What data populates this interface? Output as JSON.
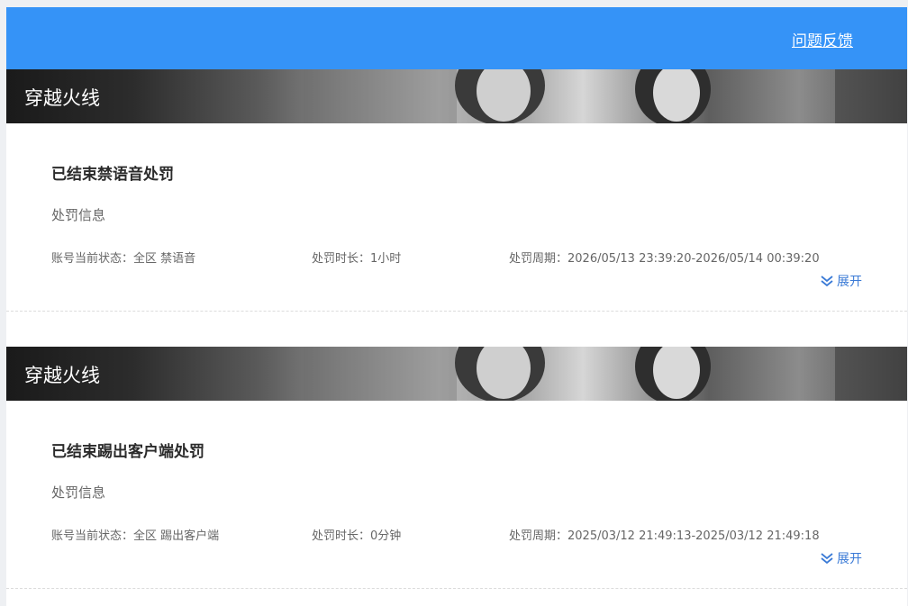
{
  "header": {
    "feedback_label": "问题反馈"
  },
  "records": [
    {
      "game": "穿越火线",
      "title": "已结束禁语音处罚",
      "info_heading": "处罚信息",
      "status_label": "账号当前状态：",
      "status_value": "全区 禁语音",
      "duration_label": "处罚时长：",
      "duration_value": "1小时",
      "period_label": "处罚周期：",
      "period_value": "2026/05/13 23:39:20-2026/05/14 00:39:20",
      "expand_label": "展开"
    },
    {
      "game": "穿越火线",
      "title": "已结束踢出客户端处罚",
      "info_heading": "处罚信息",
      "status_label": "账号当前状态：",
      "status_value": "全区 踢出客户端",
      "duration_label": "处罚时长：",
      "duration_value": "0分钟",
      "period_label": "处罚周期：",
      "period_value": "2025/03/12 21:49:13-2025/03/12 21:49:18",
      "expand_label": "展开"
    }
  ],
  "colors": {
    "header_bg": "#3593f7",
    "link_blue": "#3a7ad6",
    "title_text": "#2b2b2b",
    "muted_text": "#666666"
  },
  "icons": {
    "expand": "double-chevron-down-icon"
  }
}
